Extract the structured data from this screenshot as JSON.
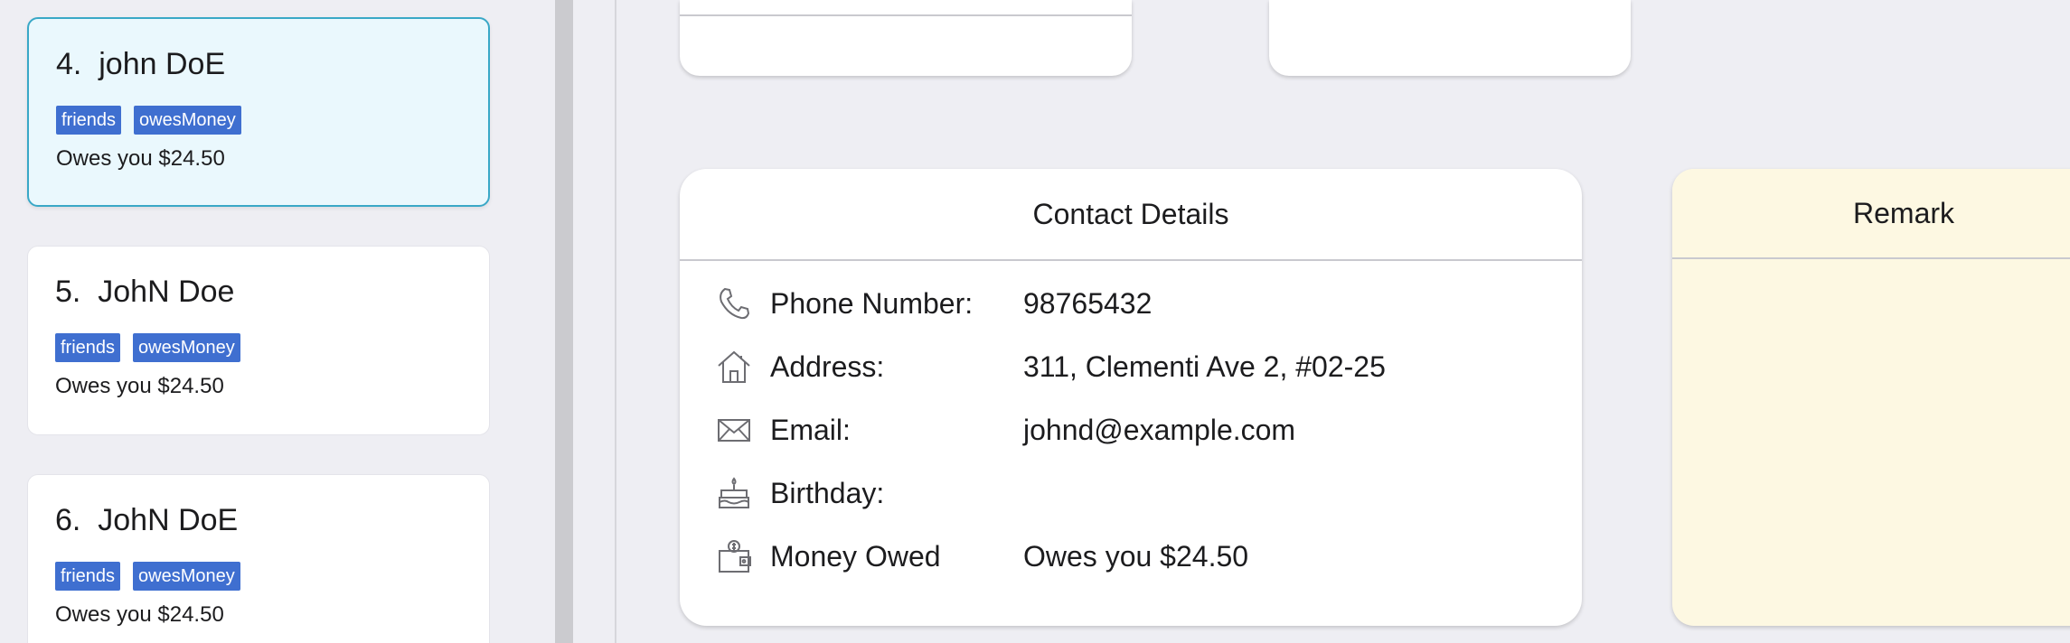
{
  "person_list": [
    {
      "index_label": "4.  john DoE",
      "tags": [
        "friends",
        "owesMoney"
      ],
      "owes": "Owes you $24.50",
      "selected": true
    },
    {
      "index_label": "5.  JohN Doe",
      "tags": [
        "friends",
        "owesMoney"
      ],
      "owes": "Owes you $24.50",
      "selected": false
    },
    {
      "index_label": "6.  JohN DoE",
      "tags": [
        "friends",
        "owesMoney"
      ],
      "owes": "Owes you $24.50",
      "selected": false
    }
  ],
  "contact_details": {
    "title": "Contact Details",
    "rows": [
      {
        "icon": "phone-icon",
        "label": "Phone Number:",
        "value": "98765432"
      },
      {
        "icon": "home-icon",
        "label": "Address:",
        "value": "311, Clementi Ave 2, #02-25"
      },
      {
        "icon": "envelope-icon",
        "label": "Email:",
        "value": "johnd@example.com"
      },
      {
        "icon": "birthday-cake-icon",
        "label": "Birthday:",
        "value": ""
      },
      {
        "icon": "wallet-icon",
        "label": "Money Owed",
        "value": "Owes you $24.50"
      }
    ]
  },
  "remark": {
    "title": "Remark",
    "background": "#fdf8e2"
  },
  "colors": {
    "tag": "#3f6fd0",
    "selected_border": "#39a8c7",
    "selected_bg": "#eaf8fd",
    "app_bg": "#eeeef3"
  }
}
